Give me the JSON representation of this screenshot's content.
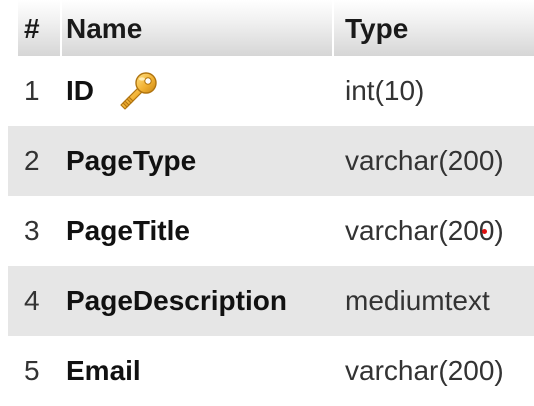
{
  "table": {
    "headers": {
      "index": "#",
      "name": "Name",
      "type": "Type"
    },
    "rows": [
      {
        "index": "1",
        "name": "ID",
        "type": "int(10)",
        "primary_key": true,
        "icon": "key-icon"
      },
      {
        "index": "2",
        "name": "PageType",
        "type": "varchar(200)"
      },
      {
        "index": "3",
        "name": "PageTitle",
        "type": "varchar(200)"
      },
      {
        "index": "4",
        "name": "PageDescription",
        "type": "mediumtext"
      },
      {
        "index": "5",
        "name": "Email",
        "type": "varchar(200)"
      }
    ]
  },
  "colors": {
    "header_gradient_top": "#ffffff",
    "header_gradient_bottom": "#d6d6d6",
    "alt_row": "#e6e6e6",
    "key_gold": "#f2b233",
    "cursor_dot": "#e01010"
  }
}
